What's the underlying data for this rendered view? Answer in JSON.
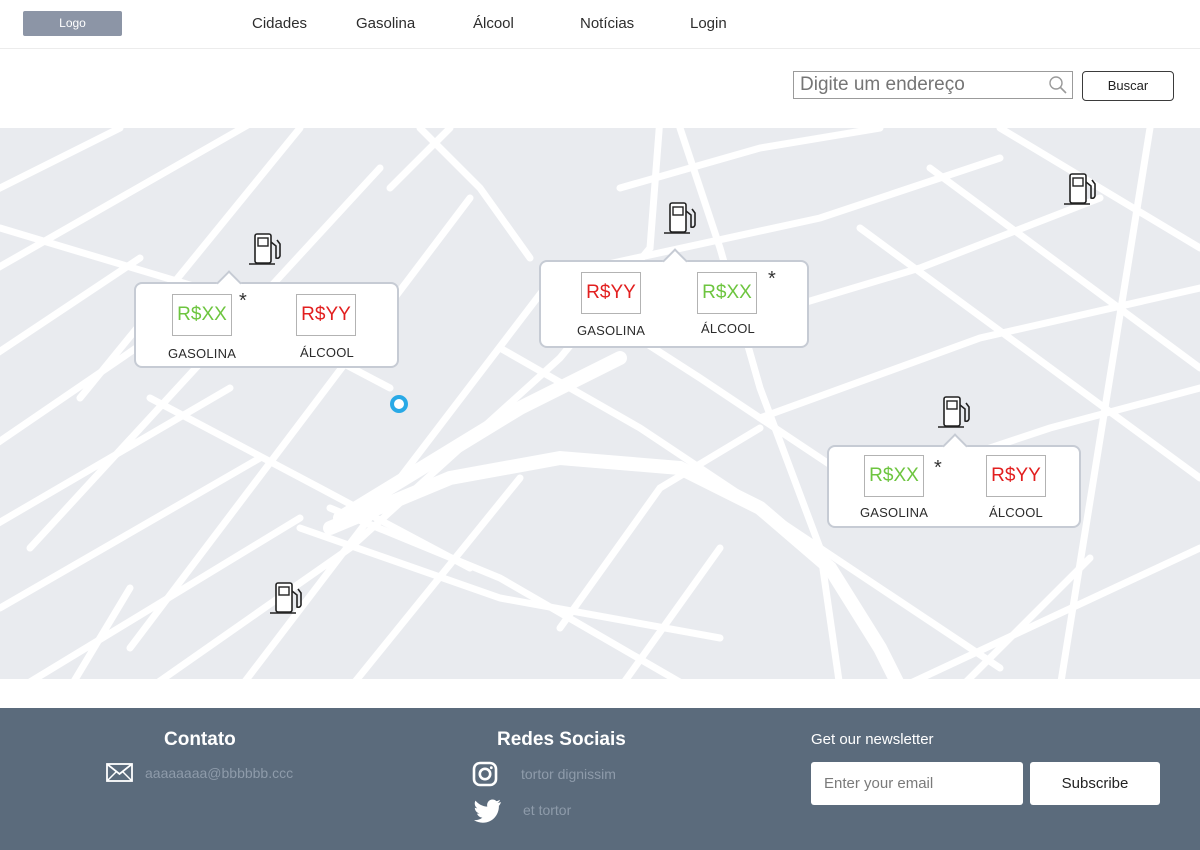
{
  "header": {
    "logo": "Logo",
    "nav": [
      "Cidades",
      "Gasolina",
      "Álcool",
      "Notícias",
      "Login"
    ]
  },
  "search": {
    "placeholder": "Digite um endereço",
    "button_label": "Buscar"
  },
  "stations": [
    {
      "gasolina_price": "R$XX",
      "gasolina_color": "green",
      "alcool_price": "R$YY",
      "alcool_color": "red",
      "asterisk": "*",
      "gasolina_label": "GASOLINA",
      "alcool_label": "ÁLCOOL"
    },
    {
      "gasolina_price": "R$YY",
      "gasolina_color": "red",
      "alcool_price": "R$XX",
      "alcool_color": "green",
      "asterisk": "*",
      "gasolina_label": "GASOLINA",
      "alcool_label": "ÁLCOOL"
    },
    {
      "gasolina_price": "R$XX",
      "gasolina_color": "green",
      "alcool_price": "R$YY",
      "alcool_color": "red",
      "asterisk": "*",
      "gasolina_label": "GASOLINA",
      "alcool_label": "ÁLCOOL"
    }
  ],
  "colors": {
    "good_price": "#6dc53f",
    "bad_price": "#e21f1f",
    "location_marker": "#29a9e6",
    "footer_bg": "#5b6b7c"
  },
  "footer": {
    "contato_title": "Contato",
    "contato_email": "aaaaaaaa@bbbbbb.ccc",
    "redes_title": "Redes Sociais",
    "instagram_text": "tortor dignissim",
    "twitter_text": "et tortor",
    "newsletter_title": "Get our newsletter",
    "email_placeholder": "Enter your email",
    "subscribe_label": "Subscribe"
  },
  "icons": {
    "search": "search-icon",
    "pump": "gas-pump-icon",
    "mail": "mail-icon",
    "instagram": "instagram-icon",
    "twitter": "twitter-icon"
  }
}
